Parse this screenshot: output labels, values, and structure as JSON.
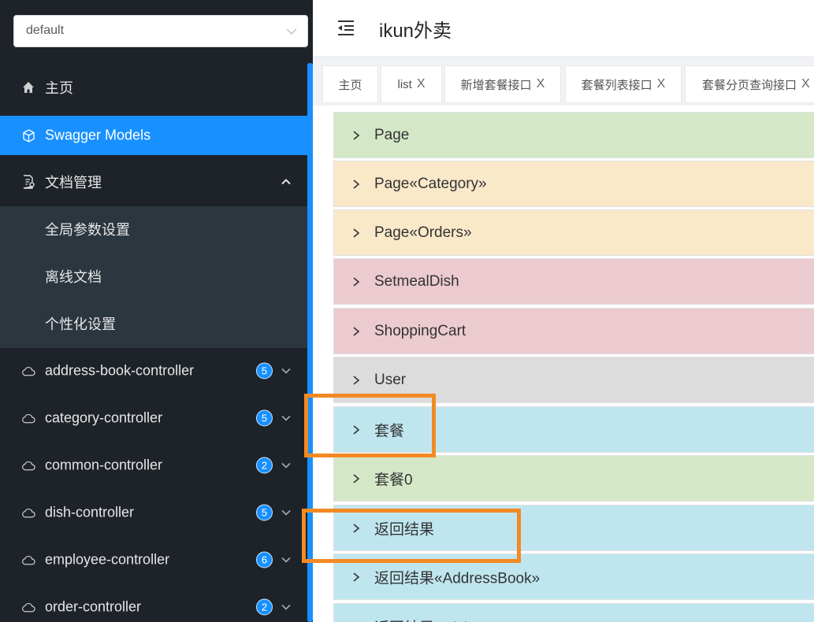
{
  "sidebar": {
    "group_select": "default",
    "home": "主页",
    "swagger_models": "Swagger Models",
    "doc_manage": "文档管理",
    "doc_sub": [
      "全局参数设置",
      "离线文档",
      "个性化设置"
    ],
    "controllers": [
      {
        "label": "address-book-controller",
        "count": "5"
      },
      {
        "label": "category-controller",
        "count": "5"
      },
      {
        "label": "common-controller",
        "count": "2"
      },
      {
        "label": "dish-controller",
        "count": "5"
      },
      {
        "label": "employee-controller",
        "count": "6"
      },
      {
        "label": "order-controller",
        "count": "2"
      }
    ]
  },
  "header": {
    "title": "ikun外卖"
  },
  "tabs": [
    {
      "label": "主页"
    },
    {
      "label": "list",
      "close": "X"
    },
    {
      "label": "新增套餐接口",
      "close": "X"
    },
    {
      "label": "套餐列表接口",
      "close": "X"
    },
    {
      "label": "套餐分页查询接口",
      "close": "X"
    }
  ],
  "models": [
    {
      "name": "Page",
      "color": "#d4e8c8"
    },
    {
      "name": "Page«Category»",
      "color": "#f9e9c9"
    },
    {
      "name": "Page«Orders»",
      "color": "#f9e9c9"
    },
    {
      "name": "SetmealDish",
      "color": "#eccbd0"
    },
    {
      "name": "ShoppingCart",
      "color": "#eccbd0"
    },
    {
      "name": "User",
      "color": "#dcdcdc"
    },
    {
      "name": "套餐",
      "color": "#bfe6ef"
    },
    {
      "name": "套餐0",
      "color": "#d4e8c8"
    },
    {
      "name": "返回结果",
      "color": "#bfe6ef"
    },
    {
      "name": "返回结果«AddressBook»",
      "color": "#bfe6ef"
    },
    {
      "name": "返回结果«DishDto»",
      "color": "#bfe6ef"
    }
  ],
  "colors": {
    "accent": "#1890ff",
    "sidebar_bg": "#1d2329",
    "highlight": "#f28a24"
  }
}
